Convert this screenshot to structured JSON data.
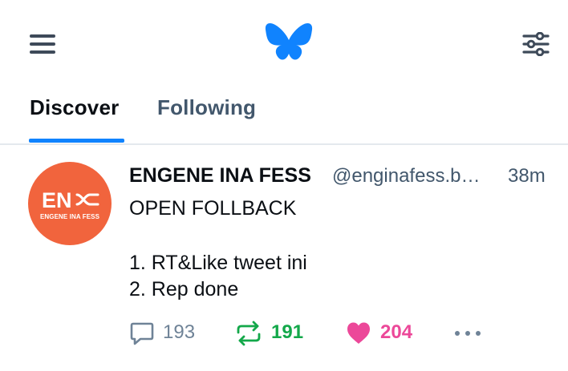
{
  "topbar": {
    "menu_icon": "hamburger-menu-icon",
    "logo_icon": "butterfly-logo-icon",
    "filter_icon": "feed-settings-sliders-icon",
    "brand_color": "#1083fe"
  },
  "tabs": [
    {
      "label": "Discover",
      "active": true
    },
    {
      "label": "Following",
      "active": false
    }
  ],
  "post": {
    "avatar": {
      "mark_text": "EN",
      "caption": "ENGENE INA FESS",
      "color": "#f1643d"
    },
    "display_name": "ENGENE INA FESS",
    "handle": "@enginafess.b…",
    "time": "38m",
    "lines": [
      "OPEN FOLLBACK",
      "1. RT&Like tweet ini",
      "2. Rep done"
    ],
    "actions": {
      "reply": {
        "icon": "reply-bubble-icon",
        "count": "193",
        "color": "#6f8397"
      },
      "repost": {
        "icon": "repost-icon",
        "count": "191",
        "color": "#13a84a"
      },
      "like": {
        "icon": "heart-icon",
        "count": "204",
        "color": "#ec4899"
      },
      "more": {
        "icon": "more-dots-icon"
      }
    }
  }
}
